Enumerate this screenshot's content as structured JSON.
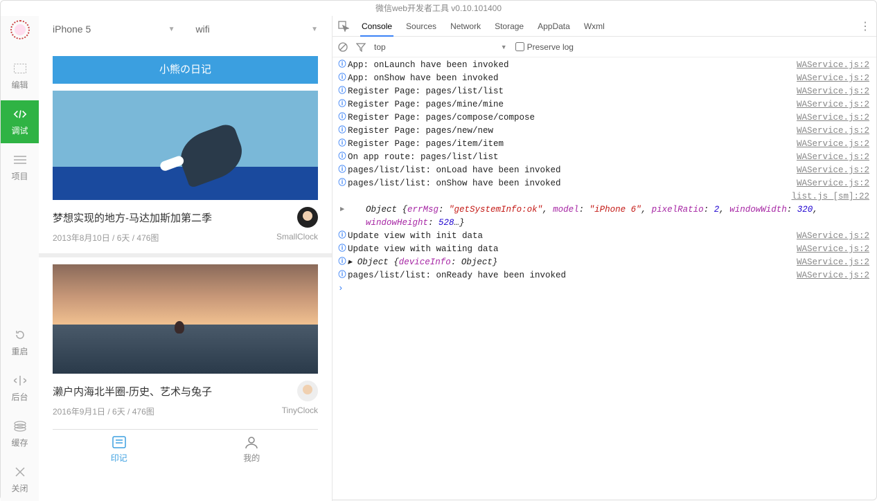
{
  "window_title": "微信web开发者工具 v0.10.101400",
  "sidebar": {
    "items": [
      {
        "key": "edit",
        "label": "编辑"
      },
      {
        "key": "debug",
        "label": "调试"
      },
      {
        "key": "project",
        "label": "项目"
      },
      {
        "key": "restart",
        "label": "重启"
      },
      {
        "key": "background",
        "label": "后台"
      },
      {
        "key": "cache",
        "label": "缓存"
      },
      {
        "key": "close",
        "label": "关闭"
      }
    ]
  },
  "device_selector": {
    "device": "iPhone 5",
    "network": "wifi"
  },
  "app": {
    "header_title": "小熊の日记",
    "cards": [
      {
        "title": "梦想实现的地方-马达加斯加第二季",
        "meta": "2013年8月10日 / 6天 / 476图",
        "author": "SmallClock"
      },
      {
        "title": "濑户内海北半圈-历史、艺术与兔子",
        "meta": "2016年9月1日 / 6天 / 476图",
        "author": "TinyClock"
      }
    ],
    "tabs": [
      {
        "key": "diary",
        "label": "印记"
      },
      {
        "key": "mine",
        "label": "我的"
      }
    ]
  },
  "devtools": {
    "tabs": [
      "Console",
      "Sources",
      "Network",
      "Storage",
      "AppData",
      "Wxml"
    ],
    "active_tab": "Console",
    "context": "top",
    "preserve_label": "Preserve log",
    "console": [
      {
        "t": "info",
        "msg": "App: onLaunch have been invoked",
        "src": "WAService.js:2"
      },
      {
        "t": "info",
        "msg": "App: onShow have been invoked",
        "src": "WAService.js:2"
      },
      {
        "t": "info",
        "msg": "Register Page: pages/list/list",
        "src": "WAService.js:2"
      },
      {
        "t": "info",
        "msg": "Register Page: pages/mine/mine",
        "src": "WAService.js:2"
      },
      {
        "t": "info",
        "msg": "Register Page: pages/compose/compose",
        "src": "WAService.js:2"
      },
      {
        "t": "info",
        "msg": "Register Page: pages/new/new",
        "src": "WAService.js:2"
      },
      {
        "t": "info",
        "msg": "Register Page: pages/item/item",
        "src": "WAService.js:2"
      },
      {
        "t": "info",
        "msg": "On app route: pages/list/list",
        "src": "WAService.js:2"
      },
      {
        "t": "info",
        "msg": "pages/list/list: onLoad have been invoked",
        "src": "WAService.js:2"
      },
      {
        "t": "info",
        "msg": "pages/list/list: onShow have been invoked",
        "src": "WAService.js:2"
      },
      {
        "t": "srcline",
        "src": "list.js [sm]:22"
      },
      {
        "t": "obj1"
      },
      {
        "t": "info",
        "msg": "Update view with init data",
        "src": "WAService.js:2"
      },
      {
        "t": "info",
        "msg": "Update view with waiting data",
        "src": "WAService.js:2"
      },
      {
        "t": "obj2",
        "src": "WAService.js:2"
      },
      {
        "t": "info",
        "msg": "pages/list/list: onReady have been invoked",
        "src": "WAService.js:2"
      }
    ],
    "obj1_parts": {
      "p0": "Object {",
      "errMsg": "errMsg",
      "c1": ": ",
      "v1": "\"getSystemInfo:ok\"",
      "c2": ", ",
      "model": "model",
      "v2": "\"iPhone 6\"",
      "pixelRatio": "pixelRatio",
      "v3": "2",
      "windowWidth": "windowWidth",
      "v4": "320",
      "windowHeight": "windowHeight",
      "v5": "528",
      "tail": "…}"
    },
    "obj2_parts": {
      "p0": "Object {",
      "deviceInfo": "deviceInfo",
      "c1": ": Object}"
    }
  }
}
